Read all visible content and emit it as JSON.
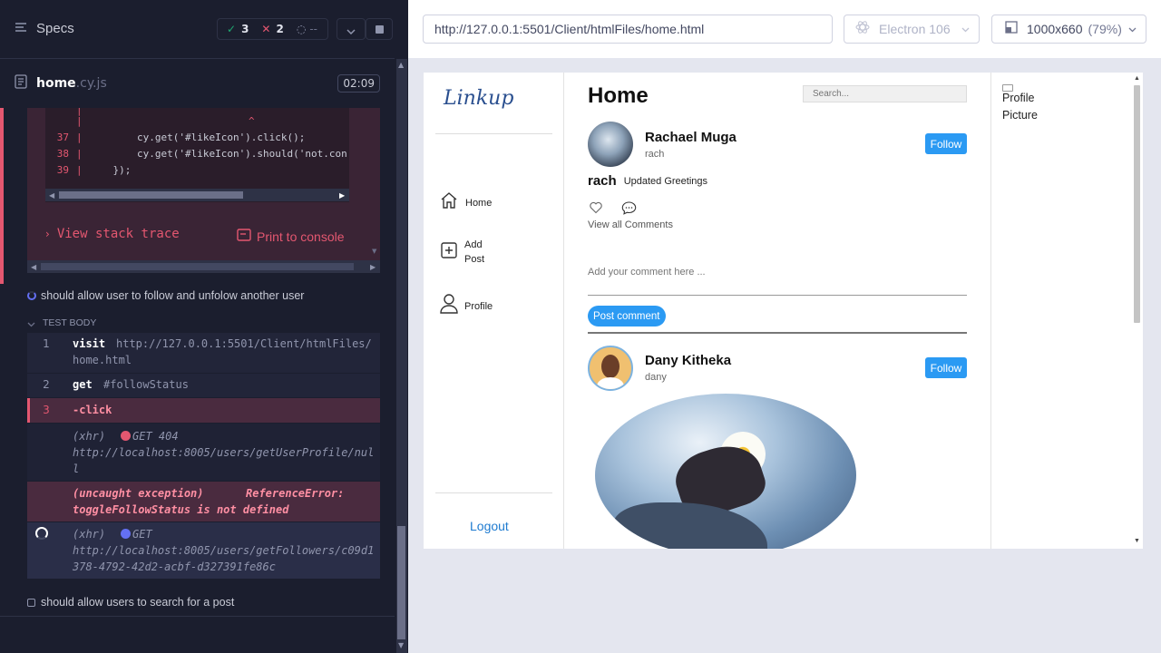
{
  "runner": {
    "specs_label": "Specs",
    "passed": "3",
    "failed": "2",
    "pending": "--",
    "file_name": "home",
    "file_ext": ".cy.js",
    "duration": "02:09"
  },
  "code_frame": {
    "caret_line": "^",
    "lines": [
      {
        "num": "37",
        "code": "        cy.get('#likeIcon').click();"
      },
      {
        "num": "38",
        "code": "        cy.get('#likeIcon').should('not.con"
      },
      {
        "num": "39",
        "code": "    });"
      }
    ],
    "view_stack_trace": "View stack trace",
    "print_to_console": "Print to console"
  },
  "test": {
    "title": "should allow user to follow and unfolow another user",
    "body_label": "TEST BODY",
    "commands": [
      {
        "num": "1",
        "name": "visit",
        "arg": "http://127.0.0.1:5501/Client/htmlFiles/",
        "arg2": "home.html"
      },
      {
        "num": "2",
        "name": "get",
        "arg": "#followStatus"
      },
      {
        "num": "3",
        "name": "-click"
      }
    ],
    "xhr1": {
      "label": "(xhr)",
      "method": "GET 404",
      "url1": "http://localhost:8005/users/getUserProfile/nul",
      "url2": "l"
    },
    "exception": {
      "label": "(uncaught exception)",
      "msg1": "ReferenceError:",
      "msg2": "toggleFollowStatus is not defined"
    },
    "xhr2": {
      "label": "(xhr)",
      "method": "GET",
      "url1": "http://localhost:8005/users/getFollowers/c09d1",
      "url2": "378-4792-42d2-acbf-d327391fe86c"
    },
    "next_test": "should allow users to search for a post"
  },
  "browser_bar": {
    "url": "http://127.0.0.1:5501/Client/htmlFiles/home.html",
    "browser": "Electron 106",
    "viewport": "1000x660",
    "scale": "(79%)"
  },
  "app": {
    "logo": "Linkup",
    "nav": {
      "home": "Home",
      "add_post_1": "Add",
      "add_post_2": "Post",
      "profile": "Profile"
    },
    "logout": "Logout",
    "page_title": "Home",
    "search_placeholder": "Search...",
    "profile_picture_alt_1": "Profile",
    "profile_picture_alt_2": "Picture",
    "post1": {
      "name": "Rachael Muga",
      "handle": "rach",
      "follow": "Follow",
      "caption_user": "rach",
      "caption_text": "Updated Greetings",
      "view_comments": "View all Comments",
      "comment_placeholder": "Add your comment here ...",
      "post_comment": "Post comment"
    },
    "post2": {
      "name": "Dany Kitheka",
      "handle": "dany",
      "follow": "Follow"
    }
  },
  "colors": {
    "accent_blue": "#2b9af3",
    "error_red": "#e45770",
    "runner_bg": "#1b1e2e",
    "pass_green": "#1fa971"
  }
}
